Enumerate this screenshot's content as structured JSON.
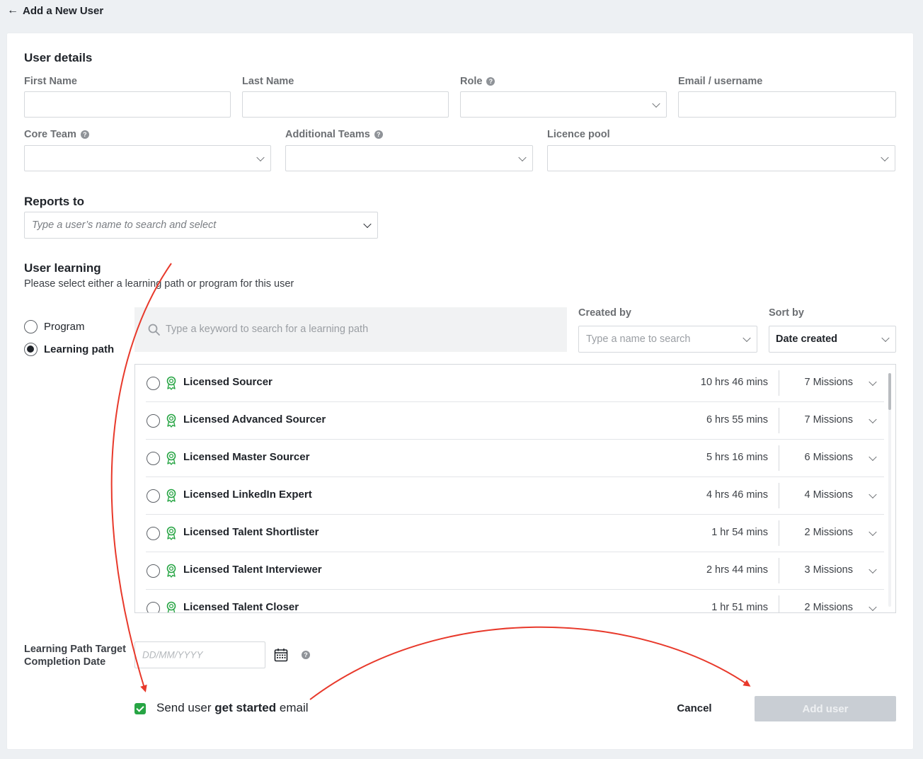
{
  "header": {
    "back_label": "Add a New User"
  },
  "user_details": {
    "title": "User details",
    "first_name_label": "First Name",
    "last_name_label": "Last Name",
    "role_label": "Role",
    "email_label": "Email / username",
    "core_team_label": "Core Team",
    "additional_teams_label": "Additional Teams",
    "licence_pool_label": "Licence pool"
  },
  "reports_to": {
    "title": "Reports to",
    "placeholder": "Type a user’s name to search and select"
  },
  "user_learning": {
    "title": "User learning",
    "subtitle": "Please select either a learning path or program for this user",
    "options": [
      {
        "label": "Program",
        "selected": false
      },
      {
        "label": "Learning path",
        "selected": true
      }
    ],
    "search_placeholder": "Type a keyword to search for a learning path",
    "created_by_label": "Created by",
    "created_by_placeholder": "Type a name to search",
    "sort_by_label": "Sort by",
    "sort_by_value": "Date created"
  },
  "learning_paths": [
    {
      "name": "Licensed Sourcer",
      "duration": "10 hrs 46 mins",
      "missions": "7 Missions"
    },
    {
      "name": "Licensed Advanced Sourcer",
      "duration": "6 hrs 55 mins",
      "missions": "7 Missions"
    },
    {
      "name": "Licensed Master Sourcer",
      "duration": "5 hrs 16 mins",
      "missions": "6 Missions"
    },
    {
      "name": "Licensed LinkedIn Expert",
      "duration": "4 hrs 46 mins",
      "missions": "4 Missions"
    },
    {
      "name": "Licensed Talent Shortlister",
      "duration": "1 hr 54 mins",
      "missions": "2 Missions"
    },
    {
      "name": "Licensed Talent Interviewer",
      "duration": "2 hrs 44 mins",
      "missions": "3 Missions"
    },
    {
      "name": "Licensed Talent Closer",
      "duration": "1 hr 51 mins",
      "missions": "2 Missions"
    }
  ],
  "completion": {
    "label": "Learning Path Target Completion Date",
    "date_placeholder": "DD/MM/YYYY"
  },
  "footer": {
    "email_prefix": "Send user ",
    "email_bold": "get started",
    "email_suffix": " email",
    "email_checked": true,
    "cancel_label": "Cancel",
    "add_label": "Add user"
  },
  "colors": {
    "accent_green": "#27a544",
    "annotation_red": "#e8392b",
    "disabled_button": "#c9ced4"
  }
}
